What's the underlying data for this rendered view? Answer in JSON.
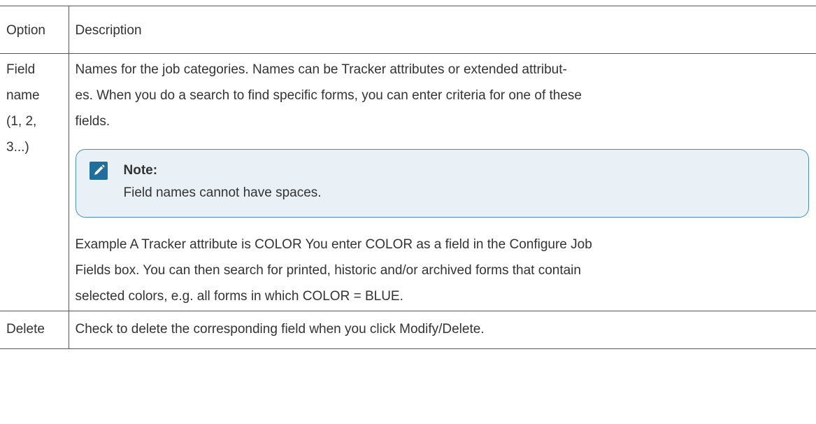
{
  "table": {
    "header": {
      "option": "Option",
      "description": "Description"
    },
    "rows": [
      {
        "option_lines": [
          "Field",
          "name",
          "(1, 2,",
          "3...)"
        ],
        "description_lines": [
          "Names for the job categories. Names can be Tracker attributes or extended attribut-",
          "es. When you do a search to find specific forms, you can enter criteria for one of these",
          "fields."
        ],
        "note": {
          "icon": "pencil-icon",
          "title": "Note:",
          "text": "Field names cannot have spaces."
        },
        "example_lines": [
          "Example A Tracker attribute is COLOR You enter COLOR as a field in the Configure Job",
          "Fields box. You can then search for printed, historic and/or archived forms that contain",
          "selected colors, e.g. all forms in which COLOR = BLUE."
        ]
      },
      {
        "option": "Delete",
        "description": "Check to delete the corresponding field when you click Modify/Delete."
      }
    ]
  },
  "colors": {
    "note_border": "#4a8fb3",
    "note_background": "#e9f1f7",
    "note_icon": "#1f6e9c",
    "text": "#333333"
  }
}
